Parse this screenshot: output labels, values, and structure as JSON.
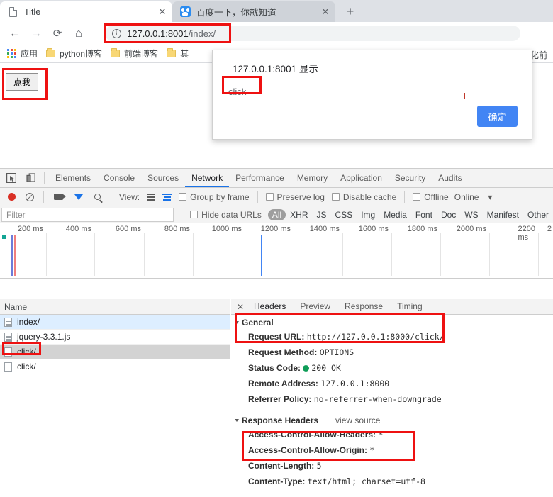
{
  "browser": {
    "tabs": [
      {
        "title": "Title",
        "favicon": "document-icon",
        "active": true,
        "close_label": "✕"
      },
      {
        "title": "百度一下，你就知道",
        "favicon": "baidu-icon",
        "active": false,
        "close_label": "✕"
      }
    ],
    "new_tab_label": "+",
    "nav": {
      "back_icon": "←",
      "forward_icon": "→",
      "reload_icon": "⟳",
      "home_icon": "⌂"
    },
    "omnibox": {
      "info_icon": "i",
      "url_host": "127.0.0.1:8001",
      "url_path": "/index/"
    },
    "bookmarks": [
      {
        "label": "应用",
        "icon": "apps-grid-icon"
      },
      {
        "label": "python博客",
        "icon": "folder-icon"
      },
      {
        "label": "前端博客",
        "icon": "folder-icon"
      },
      {
        "label": "其",
        "icon": "folder-icon"
      },
      {
        "label": "央化前",
        "icon": "none"
      }
    ]
  },
  "page": {
    "button_label": "点我"
  },
  "dialog": {
    "title": "127.0.0.1:8001 显示",
    "message": "click",
    "ok_label": "确定",
    "accent_color": "#4285f4"
  },
  "devtools": {
    "inspect_icon": "inspect-element-icon",
    "device_icon": "device-toolbar-icon",
    "tabs": [
      {
        "label": "Elements",
        "active": false
      },
      {
        "label": "Console",
        "active": false
      },
      {
        "label": "Sources",
        "active": false
      },
      {
        "label": "Network",
        "active": true
      },
      {
        "label": "Performance",
        "active": false
      },
      {
        "label": "Memory",
        "active": false
      },
      {
        "label": "Application",
        "active": false
      },
      {
        "label": "Security",
        "active": false
      },
      {
        "label": "Audits",
        "active": false
      }
    ],
    "network_toolbar": {
      "record_icon": "record-icon",
      "clear_icon": "clear-icon",
      "screenshot_icon": "camera-icon",
      "filter_icon": "funnel-icon",
      "search_icon": "search-icon",
      "view_label": "View:",
      "list_view_icon": "list-view-icon",
      "waterfall_view_icon": "waterfall-view-icon",
      "group_by_frame": "Group by frame",
      "preserve_log": "Preserve log",
      "disable_cache": "Disable cache",
      "offline": "Offline",
      "throttling": "Online",
      "throttling_caret": "▾"
    },
    "filter_bar": {
      "filter_placeholder": "Filter",
      "hide_data_urls": "Hide data URLs",
      "types": [
        "All",
        "XHR",
        "JS",
        "CSS",
        "Img",
        "Media",
        "Font",
        "Doc",
        "WS",
        "Manifest",
        "Other"
      ],
      "active_type": "All"
    },
    "overview": {
      "ticks": [
        "200 ms",
        "400 ms",
        "600 ms",
        "800 ms",
        "1000 ms",
        "1200 ms",
        "1400 ms",
        "1600 ms",
        "1800 ms",
        "2000 ms",
        "2200 ms",
        "2"
      ],
      "dom_content_loaded_color": "#1a73e8",
      "load_color": "#d93025",
      "marker_color": "#12a594"
    },
    "requests": {
      "column_header": "Name",
      "rows": [
        {
          "name": "index/",
          "icon": "document-icon",
          "state": "highlight"
        },
        {
          "name": "jquery-3.3.1.js",
          "icon": "document-icon",
          "state": "normal"
        },
        {
          "name": "click/",
          "icon": "blank-document-icon",
          "state": "selected"
        },
        {
          "name": "click/",
          "icon": "blank-document-icon",
          "state": "normal"
        }
      ]
    },
    "detail": {
      "close_label": "✕",
      "tabs": [
        {
          "label": "Headers",
          "active": true
        },
        {
          "label": "Preview",
          "active": false
        },
        {
          "label": "Response",
          "active": false
        },
        {
          "label": "Timing",
          "active": false
        }
      ],
      "general": {
        "section_title": "General",
        "items": [
          {
            "key": "Request URL:",
            "value": "http://127.0.0.1:8000/click/"
          },
          {
            "key": "Request Method:",
            "value": "OPTIONS"
          },
          {
            "key": "Status Code:",
            "value": "200 OK",
            "status_dot": true
          },
          {
            "key": "Remote Address:",
            "value": "127.0.0.1:8000"
          },
          {
            "key": "Referrer Policy:",
            "value": "no-referrer-when-downgrade"
          }
        ]
      },
      "response_headers": {
        "section_title": "Response Headers",
        "view_source": "view source",
        "items": [
          {
            "key": "Access-Control-Allow-Headers:",
            "value": "*"
          },
          {
            "key": "Access-Control-Allow-Origin:",
            "value": "*"
          },
          {
            "key": "Content-Length:",
            "value": "5"
          },
          {
            "key": "Content-Type:",
            "value": "text/html; charset=utf-8"
          }
        ]
      }
    }
  },
  "annotations": {
    "color": "#ee1111",
    "boxes": [
      "omnibox-url",
      "page-button",
      "dialog-message",
      "request-click-row",
      "general-request-url",
      "cors-headers"
    ]
  }
}
